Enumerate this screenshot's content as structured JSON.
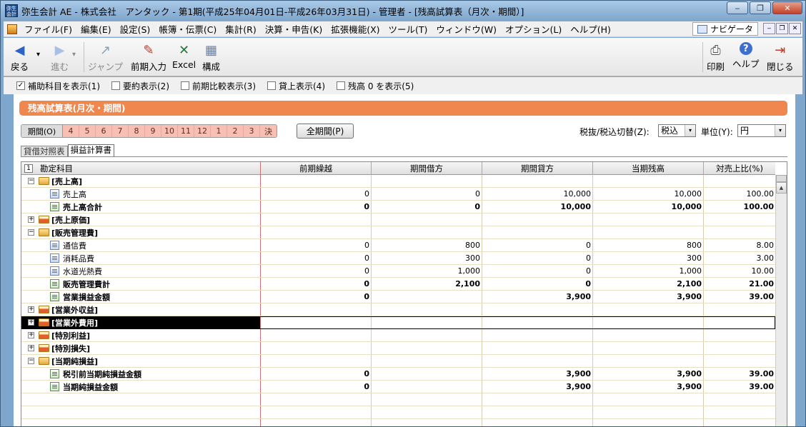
{
  "window": {
    "app_icon": "弥生\n会計",
    "title": "弥生会計 AE - 株式会社　アンタック - 第1期(平成25年04月01日-平成26年03月31日) - 管理者 - [残高試算表（月次・期間）]",
    "controls": [
      "‒",
      "❐",
      "✕"
    ]
  },
  "menu": {
    "items": [
      "ファイル(F)",
      "編集(E)",
      "設定(S)",
      "帳簿・伝票(C)",
      "集計(R)",
      "決算・申告(K)",
      "拡張機能(X)",
      "ツール(T)",
      "ウィンドウ(W)",
      "オプション(L)",
      "ヘルプ(H)"
    ],
    "navigator": "ナビゲータ",
    "mdi_controls": [
      "‒",
      "❐",
      "✕"
    ]
  },
  "toolbar": {
    "back": "戻る",
    "forward": "進む",
    "jump": "ジャンプ",
    "prior_input": "前期入力",
    "excel": "Excel",
    "compose": "構成",
    "print": "印刷",
    "help": "ヘルプ",
    "close": "閉じる",
    "icons": {
      "back": "◀",
      "dropdown": "▾",
      "forward": "▶",
      "jump": "↗",
      "prior_input": "✎",
      "excel": "✕",
      "compose": "▦",
      "print": "⎙",
      "help": "?",
      "close": "⇥"
    }
  },
  "options": [
    {
      "label": "補助科目を表示(1)",
      "checked": true
    },
    {
      "label": "要約表示(2)",
      "checked": false
    },
    {
      "label": "前期比較表示(3)",
      "checked": false
    },
    {
      "label": "貸上表示(4)",
      "checked": false
    },
    {
      "label": "残高 0 を表示(5)",
      "checked": false
    }
  ],
  "check_mark": "✓",
  "report": {
    "title": "残高試算表(月次・期間)",
    "period_label": "期間(O)",
    "months": [
      "4",
      "5",
      "6",
      "7",
      "8",
      "9",
      "10",
      "11",
      "12",
      "1",
      "2",
      "3",
      "決"
    ],
    "all_period": "全期間(P)",
    "tax_label": "税抜/税込切替(Z):",
    "tax_value": "税込",
    "unit_label": "単位(Y):",
    "unit_value": "円",
    "tabs": [
      "貸借対照表",
      "損益計算書"
    ],
    "active_tab": "損益計算書"
  },
  "grid": {
    "col_num": "1",
    "headers": [
      "勘定科目",
      "前期繰越",
      "期間借方",
      "期間貸方",
      "当期残高",
      "対売上比(%)"
    ],
    "expand_icon": "+",
    "collapse_icon": "−",
    "rows": [
      {
        "type": "group",
        "expanded": true,
        "name": "[売上高]",
        "vals": [
          "",
          "",
          "",
          "",
          ""
        ]
      },
      {
        "type": "item",
        "name": "売上高",
        "vals": [
          "0",
          "0",
          "10,000",
          "10,000",
          "100.00"
        ]
      },
      {
        "type": "sum",
        "name": "売上高合計",
        "vals": [
          "0",
          "0",
          "10,000",
          "10,000",
          "100.00"
        ]
      },
      {
        "type": "group",
        "expanded": false,
        "name": "[売上原価]",
        "vals": [
          "",
          "",
          "",
          "",
          ""
        ]
      },
      {
        "type": "group",
        "expanded": true,
        "name": "[販売管理費]",
        "vals": [
          "",
          "",
          "",
          "",
          ""
        ]
      },
      {
        "type": "item",
        "name": "通信費",
        "vals": [
          "0",
          "800",
          "0",
          "800",
          "8.00"
        ]
      },
      {
        "type": "item",
        "name": "消耗品費",
        "vals": [
          "0",
          "300",
          "0",
          "300",
          "3.00"
        ]
      },
      {
        "type": "item",
        "name": "水道光熱費",
        "vals": [
          "0",
          "1,000",
          "0",
          "1,000",
          "10.00"
        ]
      },
      {
        "type": "sum",
        "name": "販売管理費計",
        "vals": [
          "0",
          "2,100",
          "0",
          "2,100",
          "21.00"
        ]
      },
      {
        "type": "sum",
        "name": "営業損益金額",
        "vals": [
          "0",
          "",
          "3,900",
          "3,900",
          "39.00"
        ]
      },
      {
        "type": "group",
        "expanded": false,
        "name": "[営業外収益]",
        "vals": [
          "",
          "",
          "",
          "",
          ""
        ]
      },
      {
        "type": "group",
        "expanded": false,
        "name": "[営業外費用]",
        "selected": true,
        "vals": [
          "",
          "",
          "",
          "",
          ""
        ]
      },
      {
        "type": "group",
        "expanded": false,
        "name": "[特別利益]",
        "vals": [
          "",
          "",
          "",
          "",
          ""
        ]
      },
      {
        "type": "group",
        "expanded": false,
        "name": "[特別損失]",
        "vals": [
          "",
          "",
          "",
          "",
          ""
        ]
      },
      {
        "type": "group",
        "expanded": true,
        "name": "[当期純損益]",
        "vals": [
          "",
          "",
          "",
          "",
          ""
        ]
      },
      {
        "type": "sum",
        "name": "税引前当期純損益金額",
        "vals": [
          "0",
          "",
          "3,900",
          "3,900",
          "39.00"
        ]
      },
      {
        "type": "sum",
        "name": "当期純損益金額",
        "vals": [
          "0",
          "",
          "3,900",
          "3,900",
          "39.00"
        ]
      },
      {
        "type": "empty",
        "name": "",
        "vals": [
          "",
          "",
          "",
          "",
          ""
        ]
      },
      {
        "type": "empty",
        "name": "",
        "vals": [
          "",
          "",
          "",
          "",
          ""
        ]
      },
      {
        "type": "empty",
        "name": "",
        "vals": [
          "",
          "",
          "",
          "",
          ""
        ]
      }
    ],
    "scroll_up": "▲"
  }
}
